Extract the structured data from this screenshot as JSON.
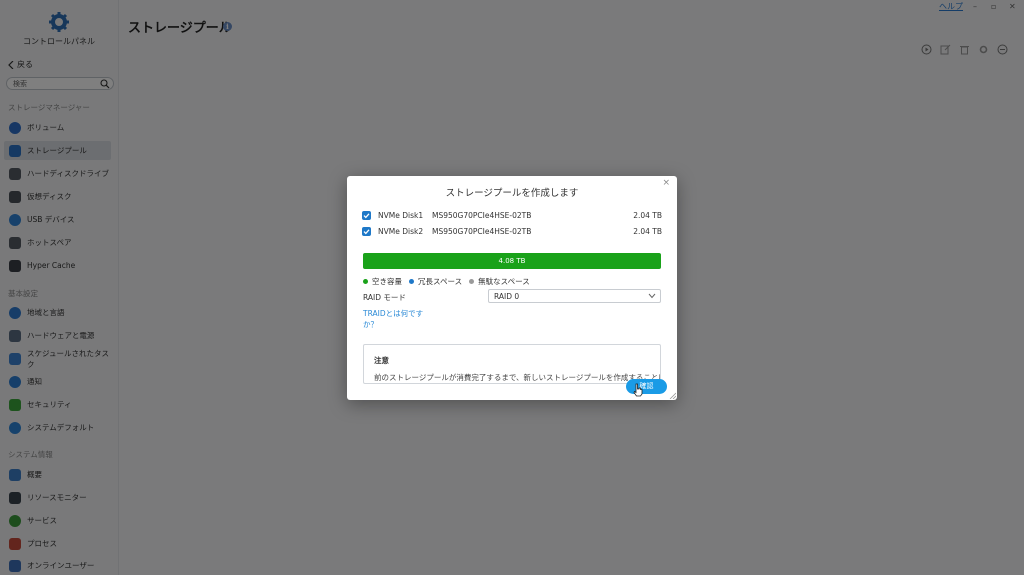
{
  "window": {
    "help_label": "ヘルプ",
    "minimize": "–",
    "maximize": "▫",
    "close": "✕"
  },
  "sidebar": {
    "app_title": "コントロールパネル",
    "back_label": "戻る",
    "search_placeholder": "検索",
    "sections": [
      {
        "label": "ストレージマネージャー",
        "items": [
          {
            "label": "ボリューム",
            "icon": "volume-icon",
            "color": "#2f6fc9"
          },
          {
            "label": "ストレージプール",
            "icon": "storage-pool-icon",
            "color": "#2a73c7",
            "active": true
          },
          {
            "label": "ハードディスクドライブ",
            "icon": "hdd-icon",
            "color": "#555b63"
          },
          {
            "label": "仮想ディスク",
            "icon": "virtual-disk-icon",
            "color": "#4a5058"
          },
          {
            "label": "USB デバイス",
            "icon": "usb-icon",
            "color": "#2f83d6"
          },
          {
            "label": "ホットスペア",
            "icon": "hot-spare-icon",
            "color": "#555b63"
          },
          {
            "label": "Hyper Cache",
            "icon": "hyper-cache-icon",
            "color": "#3a3f47"
          }
        ]
      },
      {
        "label": "基本設定",
        "items": [
          {
            "label": "地域と言語",
            "icon": "globe-icon",
            "color": "#2f7ad0"
          },
          {
            "label": "ハードウェアと電源",
            "icon": "hardware-icon",
            "color": "#5a6d82"
          },
          {
            "label": "スケジュールされたタスク",
            "icon": "schedule-icon",
            "color": "#3c83d2"
          },
          {
            "label": "通知",
            "icon": "notification-icon",
            "color": "#2c7fd4"
          },
          {
            "label": "セキュリティ",
            "icon": "security-icon",
            "color": "#3aa63a"
          },
          {
            "label": "システムデフォルト",
            "icon": "system-default-icon",
            "color": "#2d85d8"
          }
        ]
      },
      {
        "label": "システム情報",
        "items": [
          {
            "label": "概要",
            "icon": "overview-icon",
            "color": "#3c7fc8"
          },
          {
            "label": "リソースモニター",
            "icon": "resource-monitor-icon",
            "color": "#39424c"
          },
          {
            "label": "サービス",
            "icon": "services-icon",
            "color": "#3a9a3a"
          },
          {
            "label": "プロセス",
            "icon": "process-icon",
            "color": "#c74a3a"
          },
          {
            "label": "オンラインユーザー",
            "icon": "online-users-icon",
            "color": "#3d6fb8"
          }
        ]
      }
    ]
  },
  "main": {
    "title": "ストレージプール",
    "info_glyph": "i"
  },
  "dialog": {
    "title": "ストレージプールを作成します",
    "close_glyph": "×",
    "disks": [
      {
        "name": "NVMe Disk1",
        "model": "MS950G70PCIe4HSE-02TB",
        "size": "2.04 TB",
        "checked": true
      },
      {
        "name": "NVMe Disk2",
        "model": "MS950G70PCIe4HSE-02TB",
        "size": "2.04 TB",
        "checked": true
      }
    ],
    "capacity_label": "4.08 TB",
    "legend": [
      {
        "label": "空き容量",
        "color": "#1aa21a"
      },
      {
        "label": "冗長スペース",
        "color": "#1e78c8"
      },
      {
        "label": "無駄なスペース",
        "color": "#9a9a9a"
      }
    ],
    "raid_mode_label": "RAID モード",
    "raid_mode_value": "RAID 0",
    "traid_link": "TRAIDとは何ですか？",
    "note_title": "注意",
    "note_text": "前のストレージプールが消費完了するまで、新しいストレージプールを作成することは",
    "confirm_label": "確認"
  }
}
